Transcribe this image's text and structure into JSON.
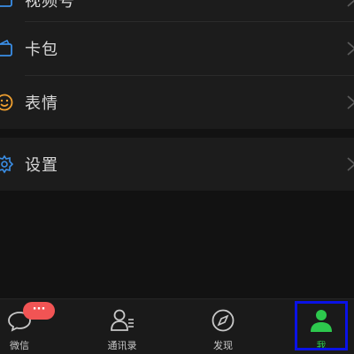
{
  "menu": {
    "items": [
      {
        "label": "视频号",
        "icon": "video-icon"
      },
      {
        "label": "卡包",
        "icon": "card-wallet-icon"
      },
      {
        "label": "表情",
        "icon": "emoji-icon"
      },
      {
        "label": "设置",
        "icon": "settings-icon"
      }
    ]
  },
  "tabbar": {
    "tabs": [
      {
        "label": "微信",
        "icon": "chat-icon",
        "badge": "···"
      },
      {
        "label": "通讯录",
        "icon": "contacts-icon"
      },
      {
        "label": "发现",
        "icon": "compass-icon"
      },
      {
        "label": "我",
        "icon": "me-icon",
        "active": true
      }
    ]
  },
  "colors": {
    "background": "#121212",
    "row": "#1c1c1c",
    "text": "#d8d8d8",
    "accent_green": "#2dc84d",
    "icon_blue": "#3a8ee6",
    "icon_orange": "#f0a030",
    "badge_red": "#f25454",
    "highlight_frame": "#0a12e6"
  }
}
